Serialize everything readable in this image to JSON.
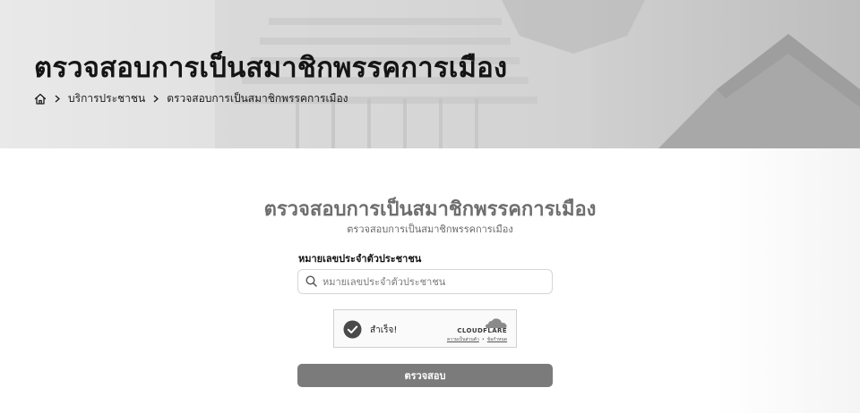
{
  "hero": {
    "title": "ตรวจสอบการเป็นสมาชิกพรรคการเมือง",
    "breadcrumb": {
      "home_icon": "home-icon",
      "items": [
        "บริการประชาชน",
        "ตรวจสอบการเป็นสมาชิกพรรคการเมือง"
      ]
    }
  },
  "form": {
    "title": "ตรวจสอบการเป็นสมาชิกพรรคการเมือง",
    "subtitle": "ตรวจสอบการเป็นสมาชิกพรรคการเมือง",
    "id_field": {
      "label": "หมายเลขประจำตัวประชาชน",
      "placeholder": "หมายเลขประจำตัวประชาชน",
      "value": "",
      "icon": "search-icon"
    },
    "captcha": {
      "status": "สำเร็จ!",
      "brand": "CLOUDFLARE",
      "privacy_link": "ความเป็นส่วนตัว",
      "separator": "•",
      "help_link": "ข้อกำหนด",
      "icon": "check-circle-icon"
    },
    "submit_label": "ตรวจสอบ"
  },
  "colors": {
    "button": "#7b7b7b",
    "title": "#6e6e6e",
    "hero_text": "#141414"
  }
}
